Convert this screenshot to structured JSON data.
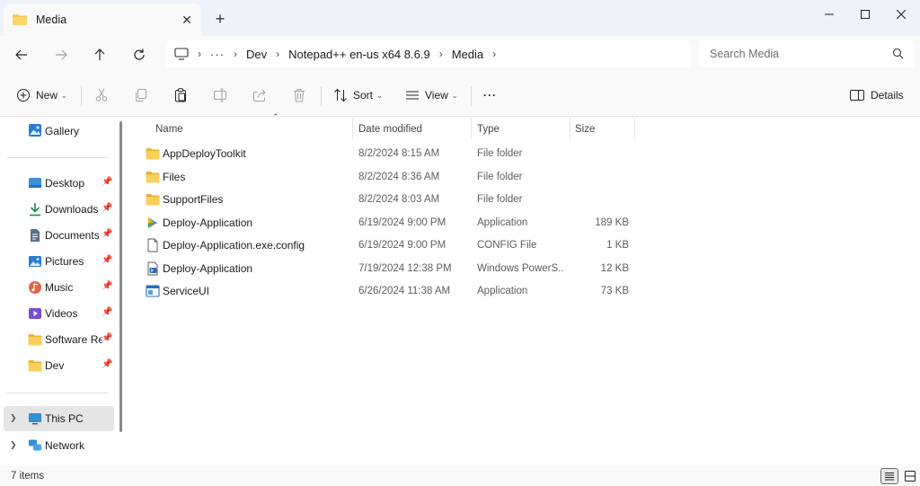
{
  "window": {
    "tab_title": "Media",
    "tab_close": "✕",
    "new_tab": "+"
  },
  "address": {
    "overflow": "···",
    "crumbs": [
      "Dev",
      "Notepad++ en-us x64 8.6.9",
      "Media"
    ],
    "separator": "›"
  },
  "search": {
    "placeholder": "Search Media"
  },
  "commands": {
    "new_label": "New",
    "sort_label": "Sort",
    "view_label": "View",
    "more_label": "···",
    "details_label": "Details"
  },
  "sidebar": {
    "gallery": "Gallery",
    "pinned": [
      {
        "label": "Desktop",
        "icon": "desktop-icon"
      },
      {
        "label": "Downloads",
        "icon": "downloads-icon"
      },
      {
        "label": "Documents",
        "icon": "documents-icon"
      },
      {
        "label": "Pictures",
        "icon": "pictures-icon"
      },
      {
        "label": "Music",
        "icon": "music-icon"
      },
      {
        "label": "Videos",
        "icon": "videos-icon"
      },
      {
        "label": "Software Rep",
        "icon": "folder-icon"
      },
      {
        "label": "Dev",
        "icon": "folder-icon"
      }
    ],
    "this_pc": "This PC",
    "network": "Network"
  },
  "columns": {
    "name": "Name",
    "date": "Date modified",
    "type": "Type",
    "size": "Size"
  },
  "files": [
    {
      "name": "AppDeployToolkit",
      "date": "8/2/2024 8:15 AM",
      "type": "File folder",
      "size": "",
      "icon": "folder-icon"
    },
    {
      "name": "Files",
      "date": "8/2/2024 8:36 AM",
      "type": "File folder",
      "size": "",
      "icon": "folder-icon"
    },
    {
      "name": "SupportFiles",
      "date": "8/2/2024 8:03 AM",
      "type": "File folder",
      "size": "",
      "icon": "folder-icon"
    },
    {
      "name": "Deploy-Application",
      "date": "6/19/2024 9:00 PM",
      "type": "Application",
      "size": "189 KB",
      "icon": "app-icon"
    },
    {
      "name": "Deploy-Application.exe.config",
      "date": "6/19/2024 9:00 PM",
      "type": "CONFIG File",
      "size": "1 KB",
      "icon": "file-icon"
    },
    {
      "name": "Deploy-Application",
      "date": "7/19/2024 12:38 PM",
      "type": "Windows PowerS...",
      "size": "12 KB",
      "icon": "powershell-script-icon"
    },
    {
      "name": "ServiceUI",
      "date": "6/26/2024 11:38 AM",
      "type": "Application",
      "size": "73 KB",
      "icon": "exe-window-icon"
    }
  ],
  "status": {
    "item_count": "7 items"
  },
  "colors": {
    "folder": "#f4c64f",
    "folder_dark": "#e8b131",
    "accent": "#0067c0",
    "chrome": "#eef3f9"
  }
}
